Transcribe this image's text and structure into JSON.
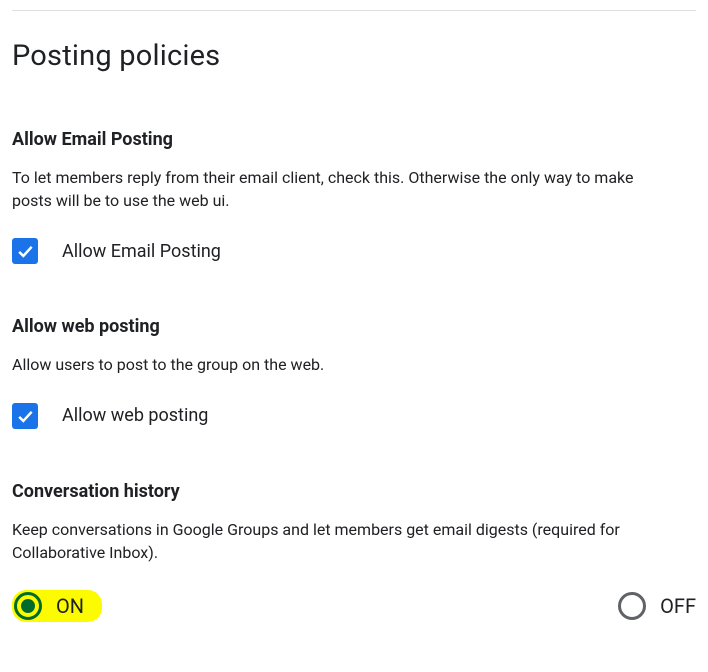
{
  "page": {
    "title": "Posting policies"
  },
  "sections": {
    "emailPosting": {
      "heading": "Allow Email Posting",
      "description": "To let members reply from their email client, check this. Otherwise the only way to make posts will be to use the web ui.",
      "checkboxLabel": "Allow Email Posting",
      "checked": true
    },
    "webPosting": {
      "heading": "Allow web posting",
      "description": "Allow users to post to the group on the web.",
      "checkboxLabel": "Allow web posting",
      "checked": true
    },
    "conversationHistory": {
      "heading": "Conversation history",
      "description": "Keep conversations in Google Groups and let members get email digests (required for Collaborative Inbox).",
      "onLabel": "ON",
      "offLabel": "OFF",
      "selected": "on"
    }
  }
}
